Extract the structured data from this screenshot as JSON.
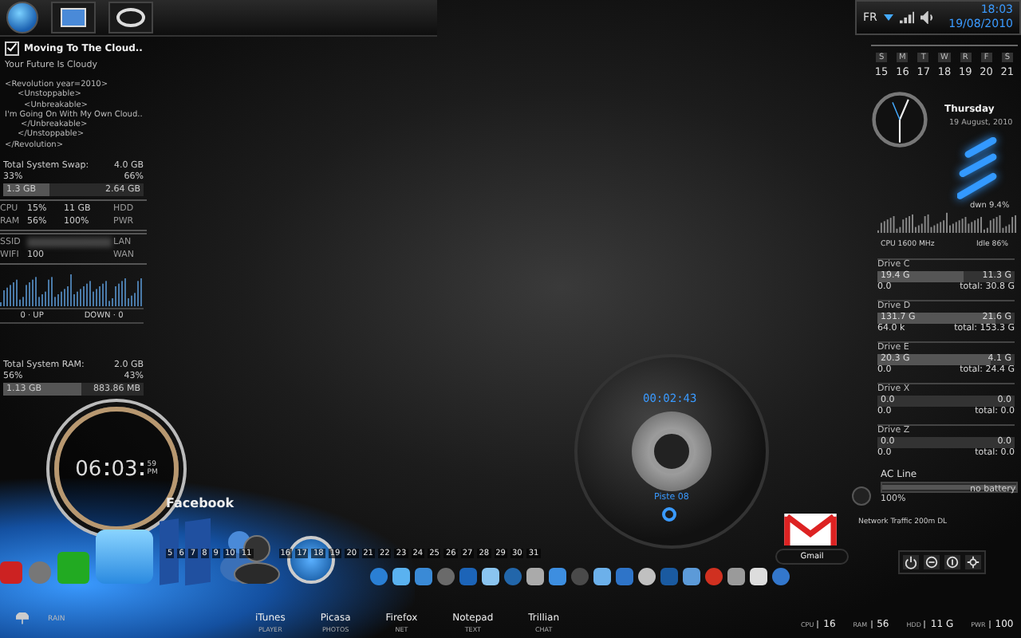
{
  "tray": {
    "language": "FR",
    "time": "18:03",
    "date": "19/08/2010"
  },
  "note": {
    "title": "Moving To The Cloud..",
    "checked": true,
    "subtitle": "Your Future Is Cloudy",
    "lines": [
      "<Revolution year=2010>",
      "<Unstoppable>",
      "<Unbreakable>",
      "I'm Going On With My Own Cloud..",
      "</Unbreakable>",
      "</Unstoppable>",
      "</Revolution>"
    ]
  },
  "swap": {
    "title": "Total System Swap:",
    "total": "4.0 GB",
    "used_pct": "33%",
    "free_pct": "66%",
    "used": "1.3 GB",
    "free": "2.64 GB",
    "level": 0.33
  },
  "system_grid": {
    "rows": [
      {
        "cells": [
          "CPU",
          "15%",
          "11 GB",
          "HDD"
        ]
      },
      {
        "cells": [
          "RAM",
          "56%",
          "100%",
          "PWR"
        ]
      }
    ],
    "ssid_label": "SSID",
    "wifi_label": "WIFI",
    "wifi_value": "100",
    "lan": "LAN",
    "wan": "WAN"
  },
  "net_meter": {
    "up": "0 · UP",
    "down": "DOWN · 0"
  },
  "ram": {
    "title": "Total System RAM:",
    "total": "2.0 GB",
    "used_pct": "56%",
    "free_pct": "43%",
    "used": "1.13 GB",
    "free": "883.86 MB",
    "level": 0.56
  },
  "clock": {
    "hours": "06",
    "minutes": "03",
    "seconds": "59",
    "meridiem": "PM"
  },
  "dock": {
    "hover_label": "Facebook",
    "weather": "RAIN",
    "calendar_days": [
      "5",
      "6",
      "7",
      "8",
      "9",
      "10",
      "11",
      "16",
      "17",
      "18",
      "19",
      "20",
      "21",
      "22",
      "23",
      "24",
      "25",
      "26",
      "27",
      "28",
      "29",
      "30",
      "31"
    ],
    "launchers": [
      {
        "name": "iTunes",
        "caption": "PLAYER"
      },
      {
        "name": "Picasa",
        "caption": "PHOTOS"
      },
      {
        "name": "Firefox",
        "caption": "NET"
      },
      {
        "name": "Notepad",
        "caption": "TEXT"
      },
      {
        "name": "Trillian",
        "caption": "CHAT"
      }
    ]
  },
  "player": {
    "time": "00:02:43",
    "track": "Piste 08"
  },
  "gmail": {
    "label": "Gmail"
  },
  "calendar": {
    "weekdays": [
      "S",
      "M",
      "T",
      "W",
      "R",
      "F",
      "S"
    ],
    "days": [
      "15",
      "16",
      "17",
      "18",
      "19",
      "20",
      "21"
    ]
  },
  "date_widget": {
    "weekday": "Thursday",
    "date": "19 August, 2010"
  },
  "cpu_monitor": {
    "download": "dwn 9.4%",
    "frequency": "CPU 1600 MHz",
    "idle": "Idle 86%"
  },
  "drives": [
    {
      "name": "Drive C",
      "used": "19.4 G",
      "free": "11.3 G",
      "activity": "0.0",
      "total": "total: 30.8 G",
      "level": 0.63
    },
    {
      "name": "Drive D",
      "used": "131.7 G",
      "free": "21.6 G",
      "activity": "64.0 k",
      "total": "total: 153.3 G",
      "level": 0.86
    },
    {
      "name": "Drive E",
      "used": "20.3 G",
      "free": "4.1 G",
      "activity": "0.0",
      "total": "total: 24.4 G",
      "level": 0.83
    },
    {
      "name": "Drive X",
      "used": "0.0",
      "free": "0.0",
      "activity": "0.0",
      "total": "total: 0.0"
    },
    {
      "name": "Drive Z",
      "used": "0.0",
      "free": "0.0",
      "activity": "0.0",
      "total": "total: 0.0"
    }
  ],
  "power": {
    "source": "AC Line",
    "status": "no battery",
    "charge": "100%",
    "level": 1
  },
  "network": {
    "label": "Network Traffic 200m DL"
  },
  "status": [
    {
      "label": "CPU",
      "value": "16"
    },
    {
      "label": "RAM",
      "value": "56"
    },
    {
      "label": "HDD",
      "value": "11 G"
    },
    {
      "label": "PWR",
      "value": "100"
    }
  ]
}
